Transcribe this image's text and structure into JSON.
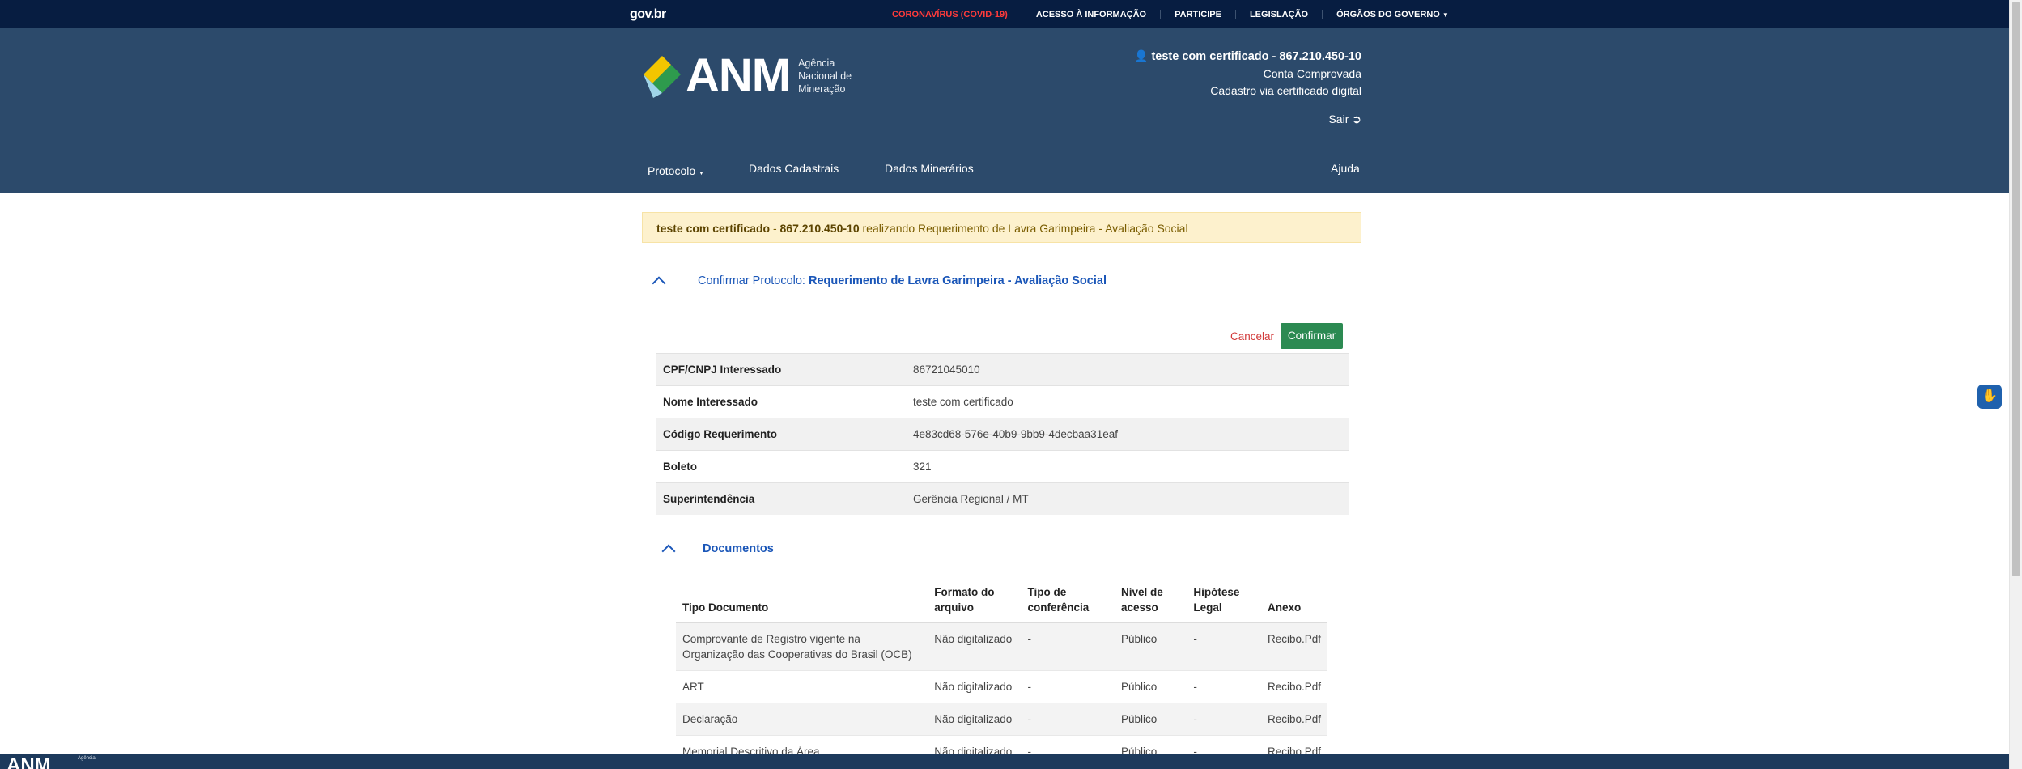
{
  "govbar": {
    "logo": "gov.br",
    "links": [
      "CORONAVÍRUS (COVID-19)",
      "ACESSO À INFORMAÇÃO",
      "PARTICIPE",
      "LEGISLAÇÃO",
      "ÓRGÃOS DO GOVERNO"
    ]
  },
  "header": {
    "brand_abbr": "ANM",
    "brand_full_1": "Agência",
    "brand_full_2": "Nacional de",
    "brand_full_3": "Mineração",
    "user_name": "teste com certificado - 867.210.450-10",
    "account_status": "Conta Comprovada",
    "registration": "Cadastro via certificado digital",
    "logout": "Sair"
  },
  "nav": {
    "protocolo": "Protocolo",
    "dados_cadastrais": "Dados Cadastrais",
    "dados_minerarios": "Dados Minerários",
    "ajuda": "Ajuda"
  },
  "alert": {
    "user": "teste com certificado",
    "sep": " - ",
    "doc": "867.210.450-10",
    "text": " realizando Requerimento de Lavra Garimpeira - Avaliação Social"
  },
  "confirm_section": {
    "prefix": "Confirmar Protocolo: ",
    "title": "Requerimento de Lavra Garimpeira - Avaliação Social",
    "cancel": "Cancelar",
    "confirm": "Confirmar"
  },
  "info": [
    {
      "label": "CPF/CNPJ Interessado",
      "value": "86721045010"
    },
    {
      "label": "Nome Interessado",
      "value": "teste com certificado"
    },
    {
      "label": "Código Requerimento",
      "value": "4e83cd68-576e-40b9-9bb9-4decbaa31eaf"
    },
    {
      "label": "Boleto",
      "value": "321"
    },
    {
      "label": "Superintendência",
      "value": "Gerência Regional / MT"
    }
  ],
  "documents": {
    "title": "Documentos",
    "headers": {
      "tipo": "Tipo Documento",
      "formato_1": "Formato do",
      "formato_2": "arquivo",
      "conferencia_1": "Tipo de",
      "conferencia_2": "conferência",
      "nivel_1": "Nível de",
      "nivel_2": "acesso",
      "hipotese_1": "Hipótese",
      "hipotese_2": "Legal",
      "anexo": "Anexo"
    },
    "rows": [
      {
        "tipo": "Comprovante de Registro vigente na Organização das Cooperativas do Brasil (OCB)",
        "formato": "Não digitalizado",
        "conferencia": "-",
        "nivel": "Público",
        "hipotese": "-",
        "anexo": "Recibo.Pdf"
      },
      {
        "tipo": "ART",
        "formato": "Não digitalizado",
        "conferencia": "-",
        "nivel": "Público",
        "hipotese": "-",
        "anexo": "Recibo.Pdf"
      },
      {
        "tipo": "Declaração",
        "formato": "Não digitalizado",
        "conferencia": "-",
        "nivel": "Público",
        "hipotese": "-",
        "anexo": "Recibo.Pdf"
      },
      {
        "tipo": "Memorial Descritivo da Área",
        "formato": "Não digitalizado",
        "conferencia": "-",
        "nivel": "Público",
        "hipotese": "-",
        "anexo": "Recibo.Pdf"
      }
    ]
  },
  "footer": {
    "logo": "ANM",
    "small": "Agência"
  },
  "colors": {
    "govbar": "#071d41",
    "header": "#2c4a6b",
    "alert_bg": "#fdf1cd",
    "link_blue": "#1a56b8",
    "confirm_green": "#2c8a52",
    "cancel_red": "#d23b3b"
  },
  "icons": [
    "user-icon",
    "logout-icon",
    "caret-down-icon",
    "chevron-up-icon",
    "accessibility-hand-icon"
  ]
}
